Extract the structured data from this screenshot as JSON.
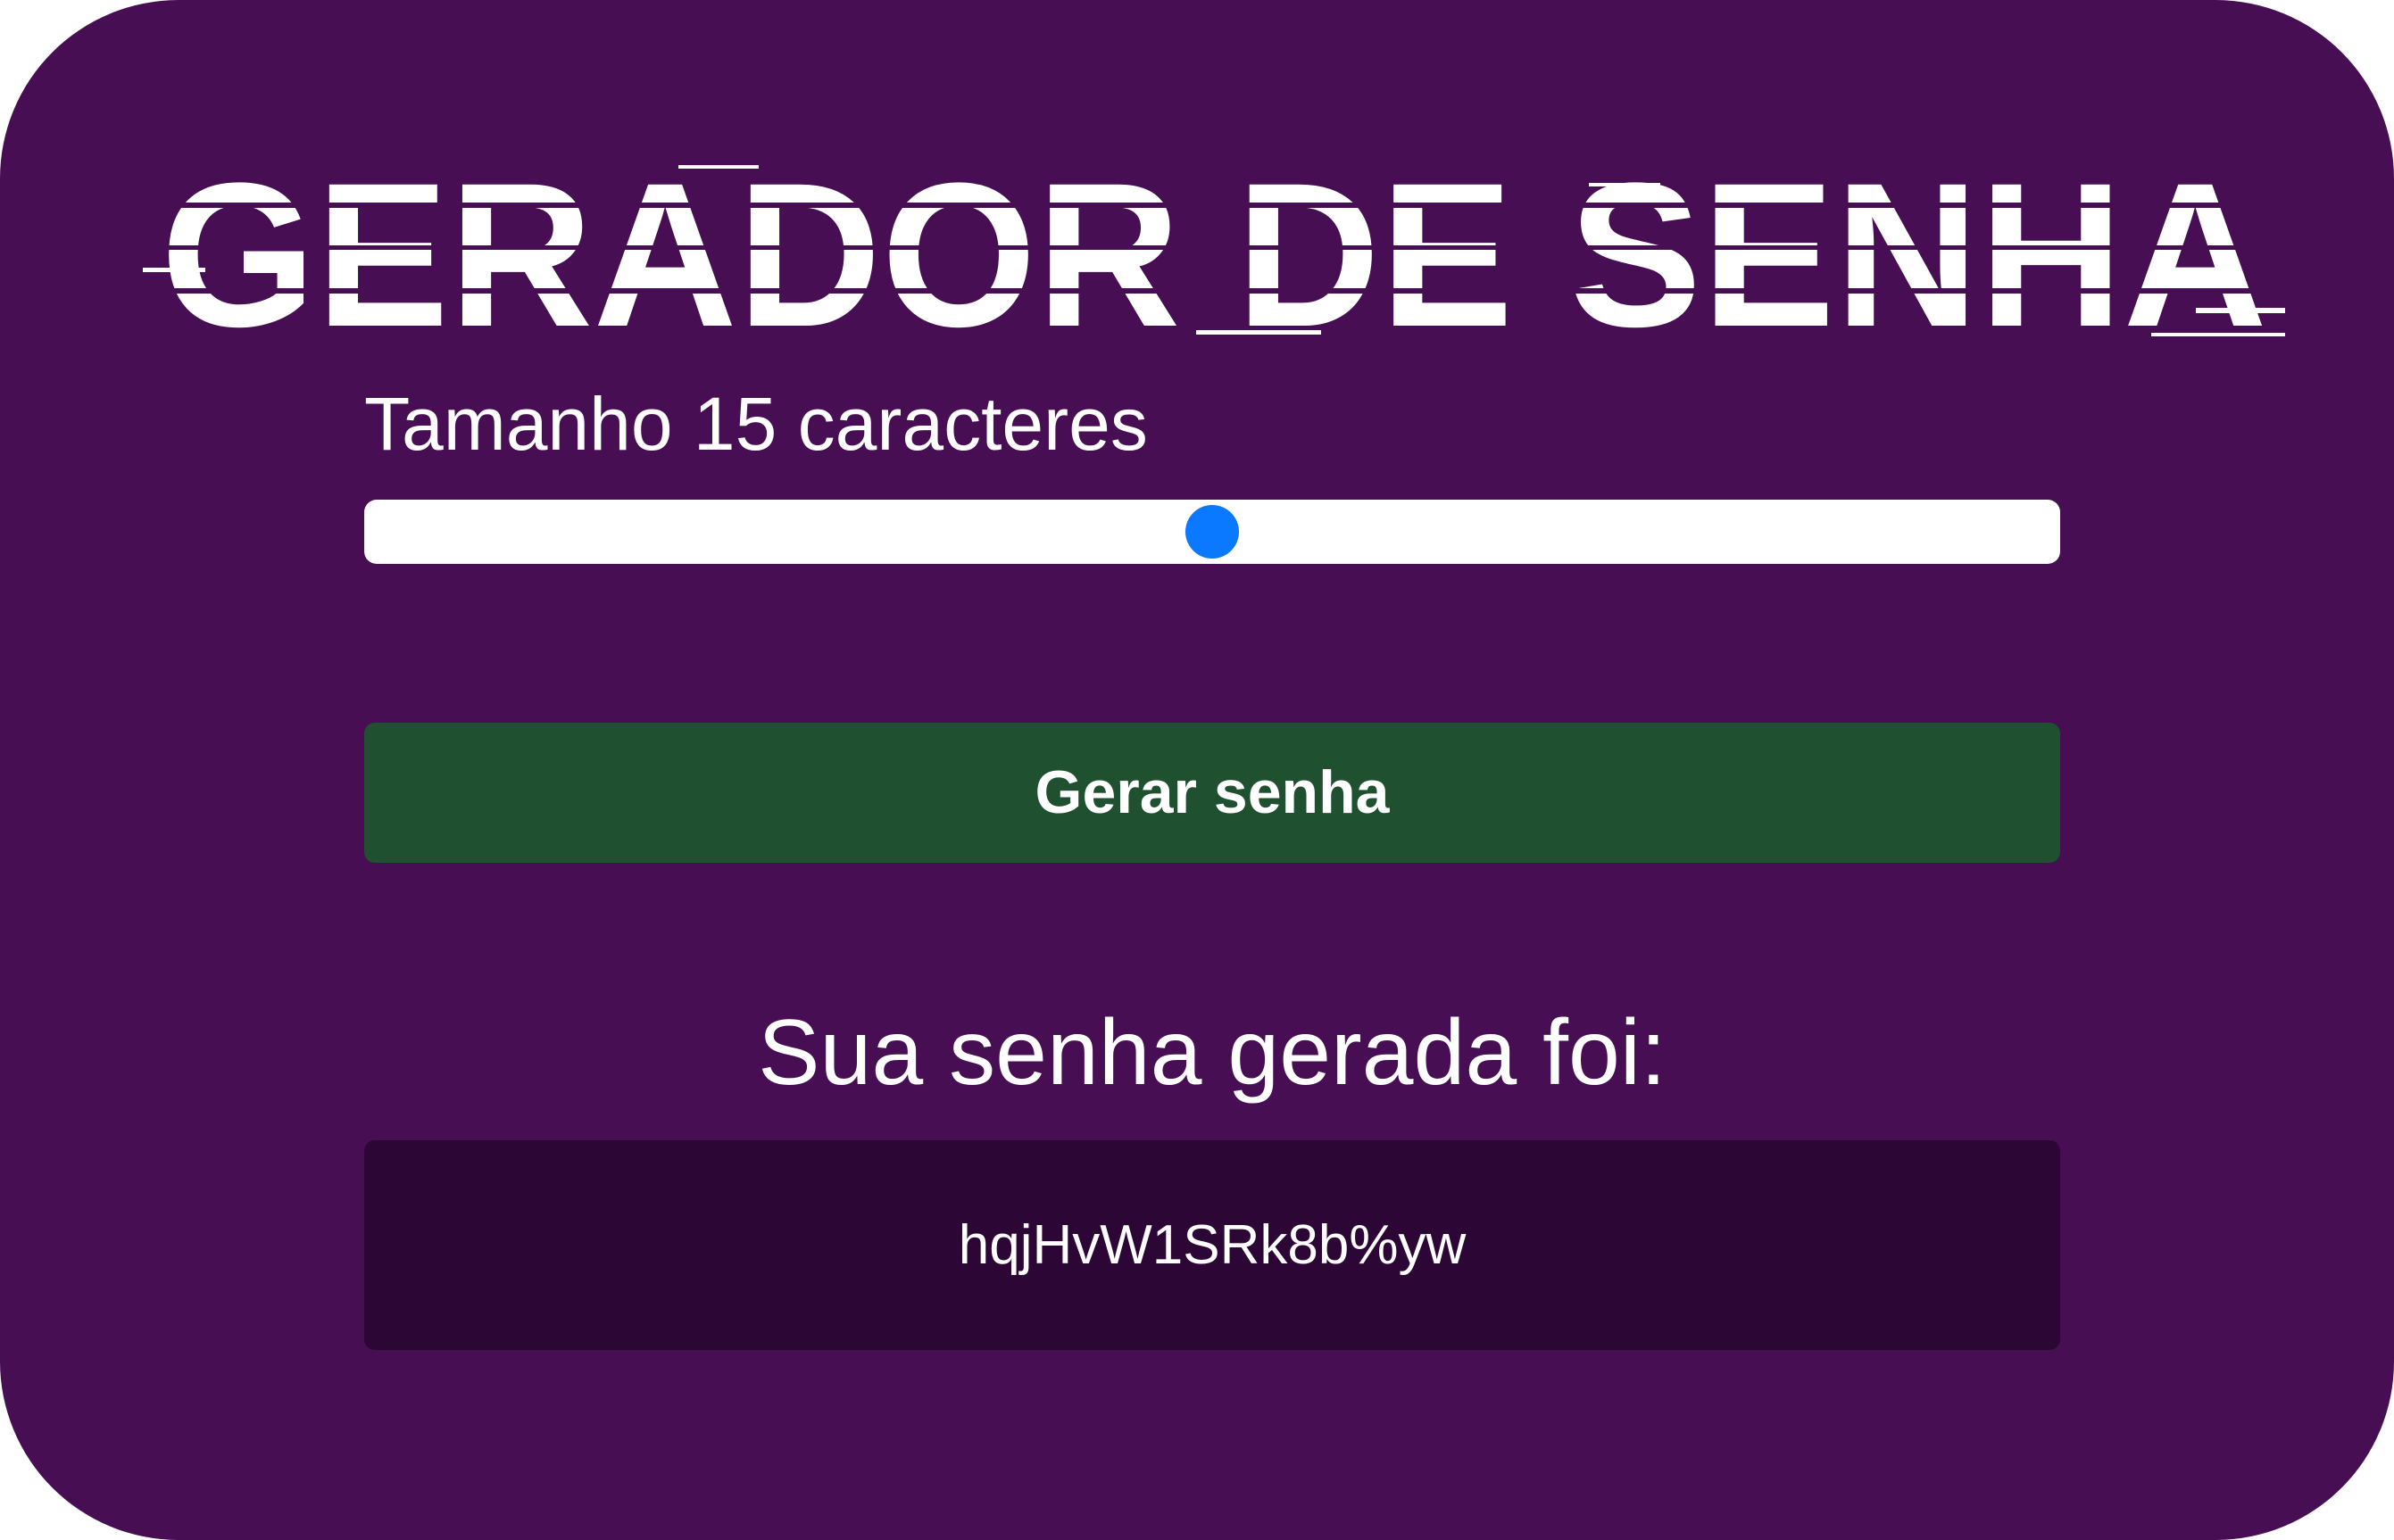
{
  "app": {
    "title": "GERADOR DE SENHA"
  },
  "length": {
    "label": "Tamanho 15 caracteres",
    "value": 15,
    "slider_fraction": 0.5
  },
  "actions": {
    "generate_label": "Gerar senha"
  },
  "result": {
    "heading": "Sua senha gerada foi:",
    "password": "hqjHvW1SRk8b%yw"
  },
  "colors": {
    "background": "#470e54",
    "button": "#1f5030",
    "password_box": "#2c0735",
    "slider_thumb": "#0a78ff",
    "text": "#ffffff"
  }
}
